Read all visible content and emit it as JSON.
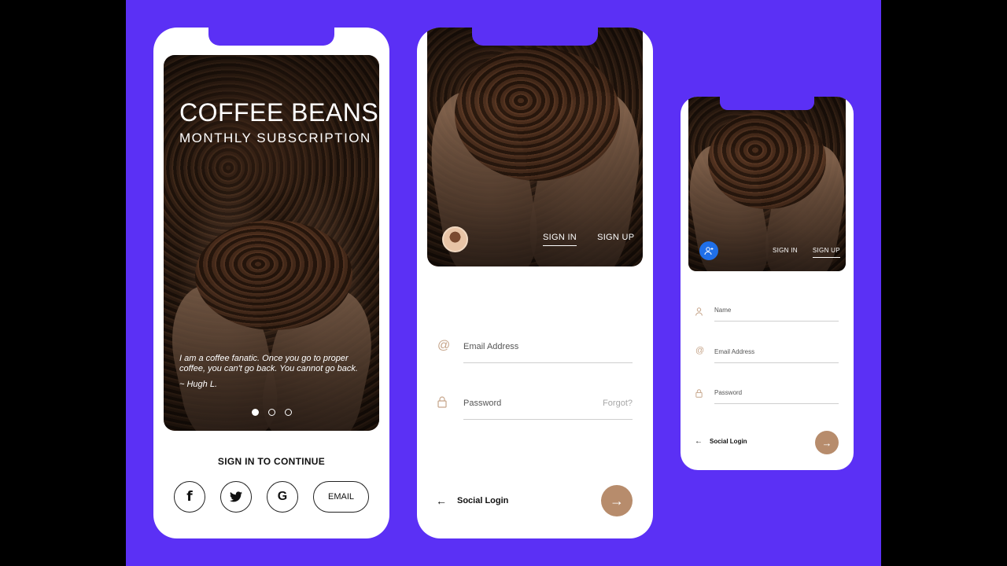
{
  "colors": {
    "background": "#5b30f5",
    "accent": "#b78c6c",
    "icon_tint": "#c6a58a",
    "blue": "#1f6fe8"
  },
  "screen1": {
    "title": "COFFEE BEANS",
    "subtitle": "MONTHLY SUBSCRIPTION",
    "quote": "I am a coffee fanatic. Once you go to proper coffee, you can't go back. You cannot go back.",
    "author": "~ Hugh L.",
    "signin_continue": "SIGN IN TO CONTINUE",
    "buttons": {
      "facebook": "f",
      "twitter": "twitter-icon",
      "google": "G",
      "email": "EMAIL"
    }
  },
  "screen2": {
    "tabs": [
      {
        "label": "SIGN IN",
        "active": true
      },
      {
        "label": "SIGN UP",
        "active": false
      }
    ],
    "email_placeholder": "Email Address",
    "password_placeholder": "Password",
    "forgot": "Forgot?",
    "social_login": "Social Login"
  },
  "screen3": {
    "tabs": [
      {
        "label": "SIGN IN",
        "active": false
      },
      {
        "label": "SIGN UP",
        "active": true
      }
    ],
    "name_placeholder": "Name",
    "email_placeholder": "Email Address",
    "password_placeholder": "Password",
    "social_login": "Social Login"
  }
}
